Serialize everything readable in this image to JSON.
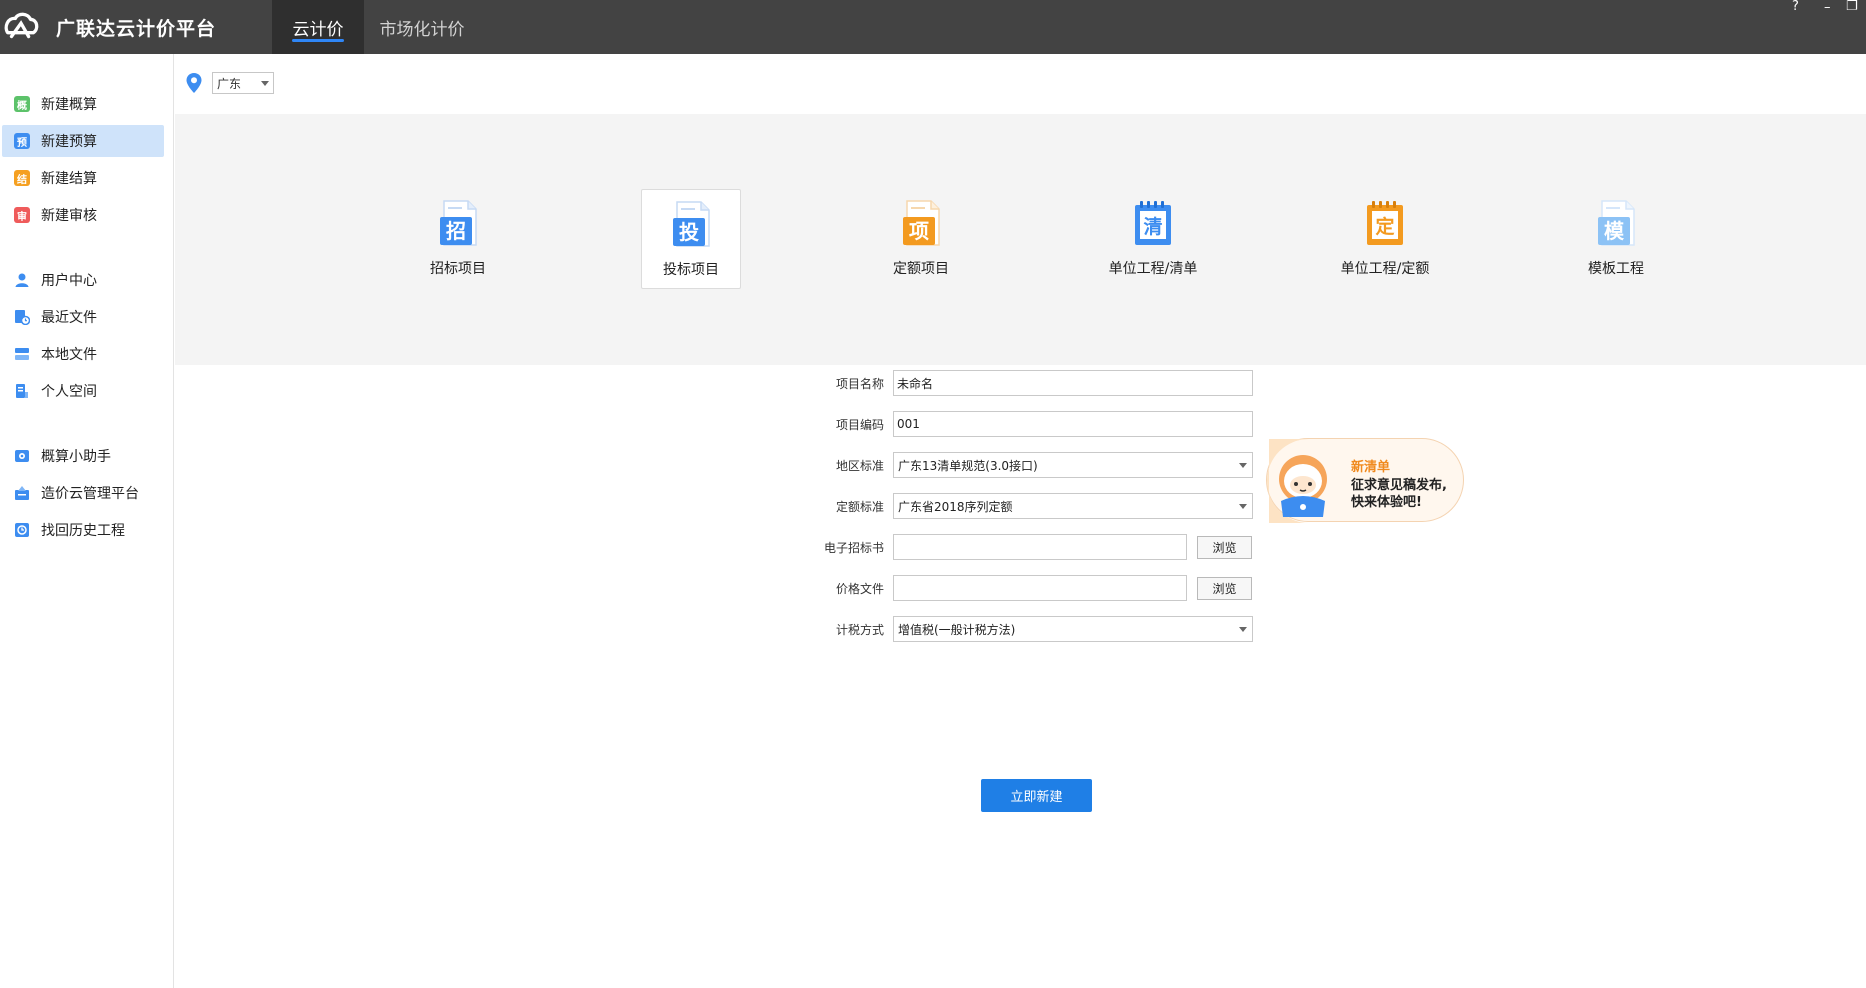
{
  "app": {
    "title": "广联达云计价平台",
    "tabs": [
      {
        "label": "云计价",
        "active": true
      },
      {
        "label": "市场化计价",
        "active": false
      }
    ],
    "window_controls": {
      "help": "?",
      "minimize": "–",
      "restore": "❐"
    }
  },
  "sidebar": {
    "groups": [
      [
        {
          "label": "新建概算",
          "icon": "gai-icon",
          "glyph": "概",
          "color": "#5cc26a"
        },
        {
          "label": "新建预算",
          "icon": "yu-icon",
          "glyph": "预",
          "color": "#3d8df0",
          "active": true
        },
        {
          "label": "新建结算",
          "icon": "jie-icon",
          "glyph": "结",
          "color": "#f5a021"
        },
        {
          "label": "新建审核",
          "icon": "shen-icon",
          "glyph": "审",
          "color": "#ef5b5b"
        }
      ],
      [
        {
          "label": "用户中心",
          "icon": "user-icon"
        },
        {
          "label": "最近文件",
          "icon": "recent-file-icon"
        },
        {
          "label": "本地文件",
          "icon": "local-file-icon"
        },
        {
          "label": "个人空间",
          "icon": "personal-space-icon"
        }
      ],
      [
        {
          "label": "概算小助手",
          "icon": "assistant-icon"
        },
        {
          "label": "造价云管理平台",
          "icon": "cloud-platform-icon"
        },
        {
          "label": "找回历史工程",
          "icon": "history-icon"
        }
      ]
    ]
  },
  "region": {
    "selected": "广东"
  },
  "project_types": [
    {
      "label": "招标项目",
      "glyph": "招",
      "color": "#3d8df0",
      "selected": false
    },
    {
      "label": "投标项目",
      "glyph": "投",
      "color": "#3d8df0",
      "selected": true
    },
    {
      "label": "定额项目",
      "glyph": "项",
      "color": "#f39a1f",
      "selected": false
    },
    {
      "label": "单位工程/清单",
      "glyph": "清",
      "color": "#3d8df0",
      "selected": false
    },
    {
      "label": "单位工程/定额",
      "glyph": "定",
      "color": "#f39a1f",
      "selected": false
    },
    {
      "label": "模板工程",
      "glyph": "模",
      "color": "#8cc2f5",
      "selected": false
    }
  ],
  "form": {
    "project_name": {
      "label": "项目名称",
      "value": "未命名"
    },
    "project_code": {
      "label": "项目编码",
      "value": "001"
    },
    "region_standard": {
      "label": "地区标准",
      "value": "广东13清单规范(3.0接口)"
    },
    "quota_standard": {
      "label": "定额标准",
      "value": "广东省2018序列定额"
    },
    "e_tender": {
      "label": "电子招标书",
      "value": "",
      "button": "浏览"
    },
    "price_file": {
      "label": "价格文件",
      "value": "",
      "button": "浏览"
    },
    "tax_method": {
      "label": "计税方式",
      "value": "增值税(一般计税方法)"
    }
  },
  "promo": {
    "title": "新清单",
    "line1": "征求意见稿发布,",
    "line2": "快来体验吧!"
  },
  "actions": {
    "create_label": "立即新建"
  }
}
